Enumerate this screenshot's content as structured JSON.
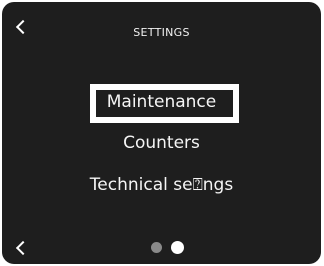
{
  "header": {
    "title": "SETTINGS",
    "back_icon": "chevron-left-icon"
  },
  "menu": {
    "items": [
      {
        "label": "Maintenance",
        "selected": true
      },
      {
        "label": "Counters",
        "selected": false
      },
      {
        "label": "Technical se⍰ngs",
        "selected": false
      }
    ]
  },
  "footer": {
    "back_icon": "chevron-left-icon",
    "pagination": {
      "total": 2,
      "current": 2
    }
  },
  "colors": {
    "background": "#1e1e1e",
    "text": "#ffffff",
    "dot_inactive": "#8a8a8a",
    "dot_active": "#ffffff"
  }
}
